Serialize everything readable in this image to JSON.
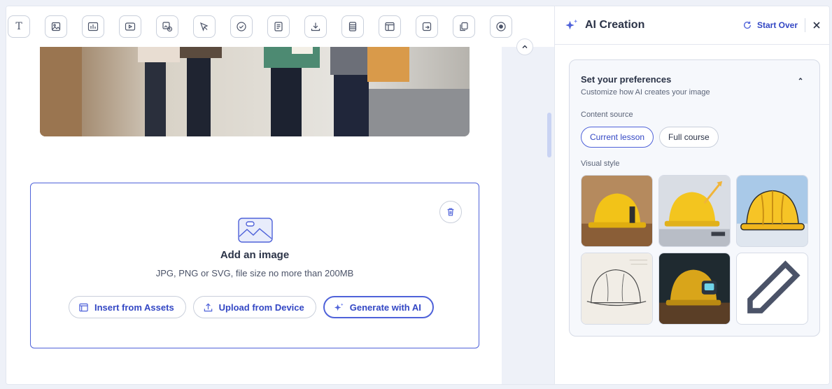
{
  "toolbar": {
    "tools": [
      "text-tool-icon",
      "image-tool-icon",
      "chart-tool-icon",
      "video-tool-icon",
      "ai-image-tool-icon",
      "pointer-tool-icon",
      "check-tool-icon",
      "document-tool-icon",
      "download-tool-icon",
      "stack-tool-icon",
      "layout-tool-icon",
      "export-tool-icon",
      "copy-tool-icon",
      "record-tool-icon"
    ],
    "text_glyph": "T"
  },
  "dropzone": {
    "title": "Add an image",
    "subtitle": "JPG, PNG or SVG, file size no more than 200MB",
    "insert_label": "Insert from Assets",
    "upload_label": "Upload from Device",
    "generate_label": "Generate with AI"
  },
  "panel": {
    "title": "AI Creation",
    "start_over": "Start Over",
    "preferences": {
      "title": "Set your preferences",
      "subtitle": "Customize how AI creates your image",
      "content_source_label": "Content source",
      "content_sources": [
        "Current lesson",
        "Full course"
      ],
      "selected_source": "Current lesson",
      "visual_style_label": "Visual style",
      "styles": [
        "photo-hardhat-workbench",
        "3d-hardhat-growth",
        "illustration-hardhat",
        "sketch-hardhat",
        "cinematic-hardhat",
        "custom-style-edit"
      ]
    }
  },
  "colors": {
    "accent": "#4f62d9",
    "accent_text": "#3347c4",
    "helmet_yellow": "#f2c318"
  }
}
